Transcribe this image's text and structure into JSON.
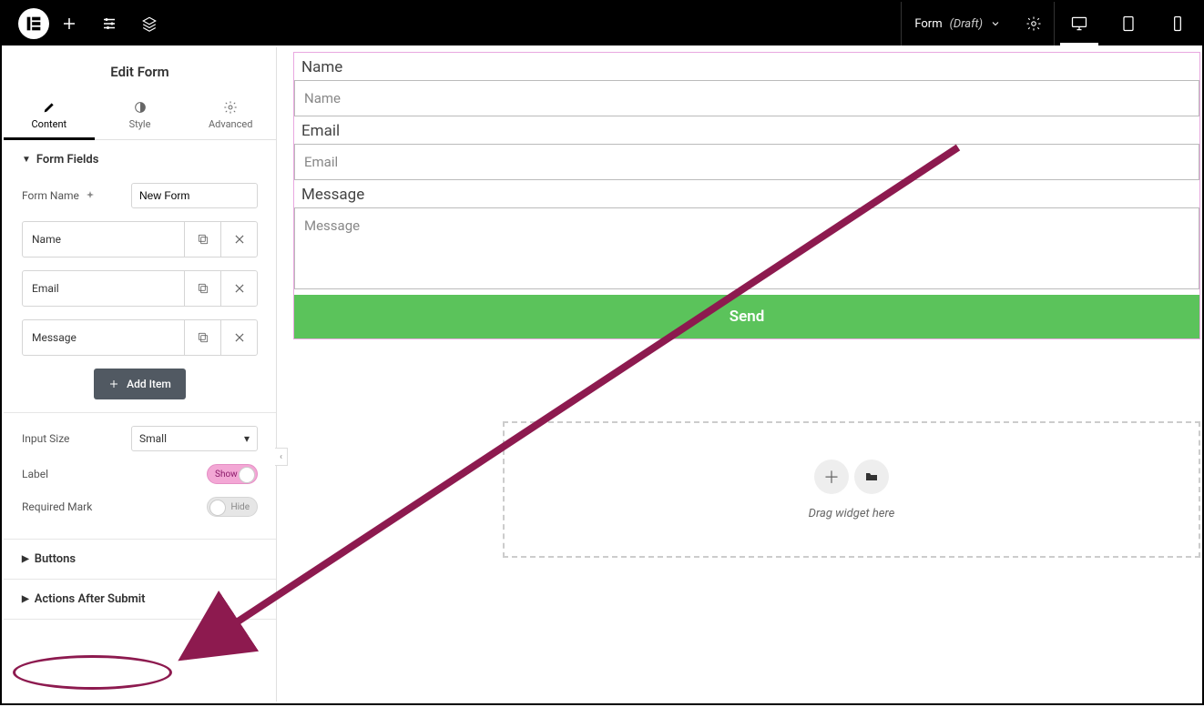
{
  "topbar": {
    "doc_name": "Form",
    "doc_status": "(Draft)"
  },
  "panel": {
    "title": "Edit Form",
    "tabs": {
      "content": "Content",
      "style": "Style",
      "advanced": "Advanced"
    },
    "sections": {
      "form_fields": {
        "title": "Form Fields",
        "form_name_label": "Form Name",
        "form_name_value": "New Form",
        "items": [
          "Name",
          "Email",
          "Message"
        ],
        "add_item": "Add Item",
        "input_size_label": "Input Size",
        "input_size_value": "Small",
        "label_label": "Label",
        "label_toggle": "Show",
        "required_label": "Required Mark",
        "required_toggle": "Hide"
      },
      "buttons": {
        "title": "Buttons"
      },
      "actions": {
        "title": "Actions After Submit"
      }
    }
  },
  "canvas": {
    "fields": [
      {
        "label": "Name",
        "placeholder": "Name",
        "type": "text"
      },
      {
        "label": "Email",
        "placeholder": "Email",
        "type": "text"
      },
      {
        "label": "Message",
        "placeholder": "Message",
        "type": "textarea"
      }
    ],
    "submit": "Send",
    "drop_hint": "Drag widget here"
  },
  "colors": {
    "annotation": "#8d1a4f",
    "submit_bg": "#5bc35b"
  }
}
